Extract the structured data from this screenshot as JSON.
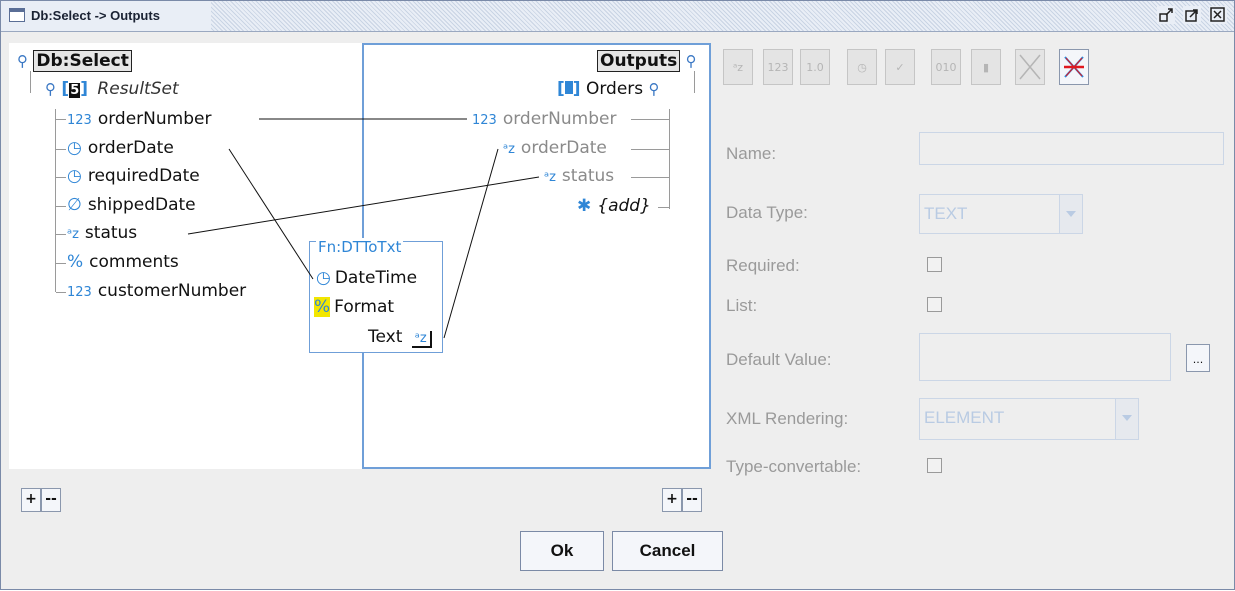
{
  "window": {
    "title": "Db:Select -> Outputs",
    "controls": [
      "restore-icon",
      "maximize-icon",
      "close-icon"
    ]
  },
  "left_tree": {
    "root": "Db:Select",
    "resultset_label": "ResultSet",
    "resultset_badge": "5",
    "fields": [
      {
        "type_icon": "123",
        "name": "orderNumber"
      },
      {
        "type_icon": "◷",
        "name": "orderDate"
      },
      {
        "type_icon": "◷",
        "name": "requiredDate"
      },
      {
        "type_icon": "∅",
        "name": "shippedDate"
      },
      {
        "type_icon": "ᵃz",
        "name": "status"
      },
      {
        "type_icon": "%",
        "name": "comments"
      },
      {
        "type_icon": "123",
        "name": "customerNumber"
      }
    ]
  },
  "right_tree": {
    "root": "Outputs",
    "orders_label": "Orders",
    "fields": [
      {
        "type_icon": "123",
        "name": "orderNumber"
      },
      {
        "type_icon": "ᵃz",
        "name": "orderDate"
      },
      {
        "type_icon": "ᵃz",
        "name": "status"
      }
    ],
    "add_label": "{add}"
  },
  "function_box": {
    "title": "Fn:DTToTxt",
    "inputs": [
      "DateTime",
      "Format"
    ],
    "output": "Text",
    "output_icon": "ᵃz"
  },
  "toolbar": {
    "buttons": [
      "text-type-icon",
      "integer-type-icon",
      "decimal-type-icon",
      "datetime-type-icon",
      "boolean-type-icon",
      "binary-type-icon",
      "document-type-icon",
      "delete-icon",
      "delete-all-icon"
    ]
  },
  "properties": {
    "name_label": "Name:",
    "name_value": "",
    "data_type_label": "Data Type:",
    "data_type_value": "TEXT",
    "required_label": "Required:",
    "list_label": "List:",
    "default_value_label": "Default Value:",
    "default_value": "",
    "browse_label": "...",
    "xml_rendering_label": "XML Rendering:",
    "xml_rendering_value": "ELEMENT",
    "type_convertable_label": "Type-convertable:"
  },
  "buttons": {
    "add": "+",
    "remove": "--",
    "ok": "Ok",
    "cancel": "Cancel"
  }
}
